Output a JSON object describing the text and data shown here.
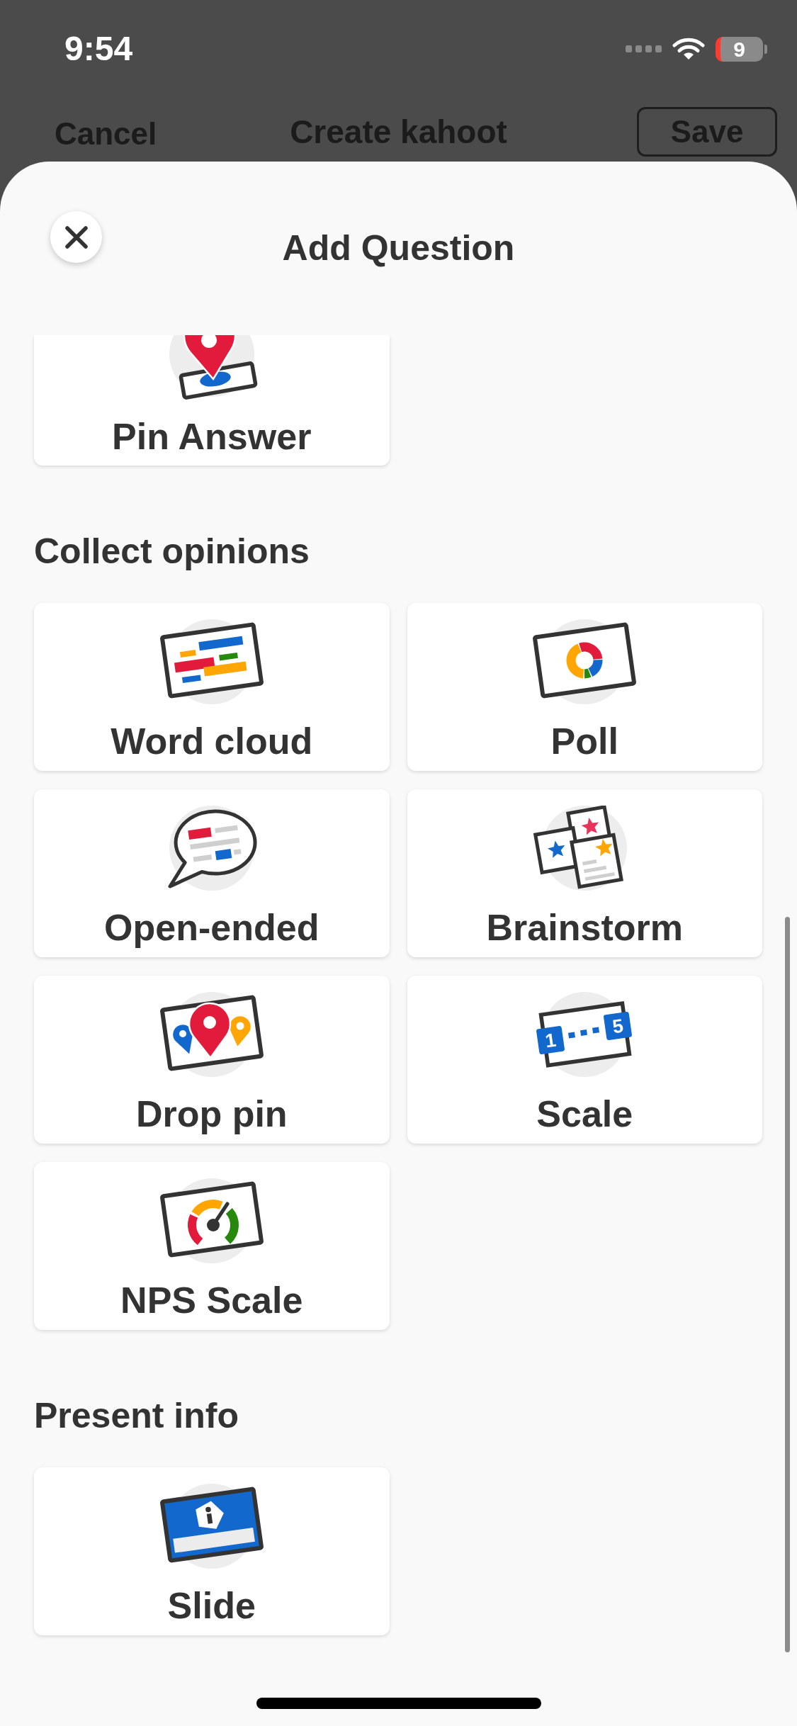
{
  "status_bar": {
    "time": "9:54",
    "battery": "9"
  },
  "background_screen": {
    "left_button": "Cancel",
    "title": "Create kahoot",
    "right_button": "Save"
  },
  "sheet": {
    "title": "Add Question"
  },
  "sections": [
    {
      "items": [
        {
          "kind": "pinanswer",
          "label": "Pin Answer",
          "clipped": true
        }
      ]
    },
    {
      "heading": "Collect opinions",
      "items": [
        {
          "kind": "wordcloud",
          "label": "Word cloud",
          "clipped": false
        },
        {
          "kind": "poll",
          "label": "Poll",
          "clipped": false
        },
        {
          "kind": "openended",
          "label": "Open-ended",
          "clipped": false
        },
        {
          "kind": "brainstorm",
          "label": "Brainstorm",
          "clipped": false
        },
        {
          "kind": "droppin",
          "label": "Drop pin",
          "clipped": false
        },
        {
          "kind": "scale",
          "label": "Scale",
          "icon_labels": [
            "1",
            "5"
          ],
          "clipped": false
        },
        {
          "kind": "nps",
          "label": "NPS Scale",
          "clipped": false
        }
      ]
    },
    {
      "heading": "Present info",
      "items": [
        {
          "kind": "slide",
          "label": "Slide",
          "clipped": false
        }
      ]
    }
  ]
}
